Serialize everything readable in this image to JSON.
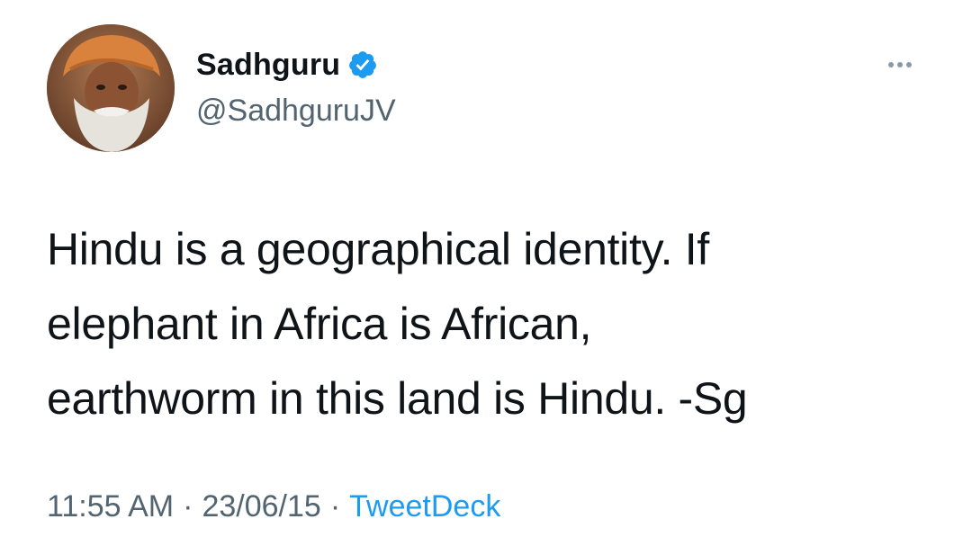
{
  "tweet": {
    "author": {
      "display_name": "Sadhguru",
      "handle": "@SadhguruJV",
      "verified": true,
      "avatar_icon": "profile-photo"
    },
    "more_icon": "ellipsis-icon",
    "text": "Hindu is a geographical identity. If\nelephant in Africa is African,\nearthworm in this land is Hindu. -Sg",
    "time": "11:55 AM",
    "separator": "·",
    "date": "23/06/15",
    "source": "TweetDeck"
  },
  "colors": {
    "text_primary": "#0f1419",
    "text_secondary": "#536471",
    "link": "#1d9bf0",
    "verified_badge": "#1d9bf0"
  }
}
